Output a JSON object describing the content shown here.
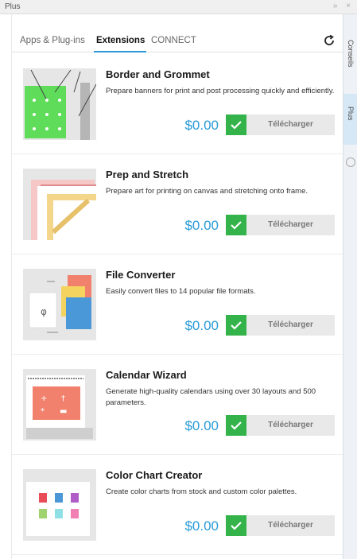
{
  "window": {
    "title": "Plus"
  },
  "tabs": [
    {
      "label": "Apps & Plug-ins",
      "active": false
    },
    {
      "label": "Extensions",
      "active": true
    },
    {
      "label": "CONNECT",
      "active": false
    }
  ],
  "items": [
    {
      "title": "Border and Grommet",
      "description": "Prepare banners for print and post processing quickly and efficiently.",
      "price": "$0.00",
      "button": "Télécharger"
    },
    {
      "title": "Prep and Stretch",
      "description": "Prepare art for printing on canvas and stretching onto frame.",
      "price": "$0.00",
      "button": "Télécharger"
    },
    {
      "title": "File Converter",
      "description": "Easily convert files to 14 popular file formats.",
      "price": "$0.00",
      "button": "Télécharger"
    },
    {
      "title": "Calendar Wizard",
      "description": "Generate high-quality calendars using over 30 layouts and 500 parameters.",
      "price": "$0.00",
      "button": "Télécharger"
    },
    {
      "title": "Color Chart Creator",
      "description": "Create color charts from stock and custom color palettes.",
      "price": "$0.00",
      "button": "Télécharger"
    }
  ],
  "sidebar": {
    "tabs": [
      {
        "label": "Conseils",
        "active": false
      },
      {
        "label": "Plus",
        "active": true
      }
    ]
  },
  "colors": {
    "accent": "#2a9bd8",
    "check": "#34b34a"
  },
  "icons": [
    "refresh-icon",
    "check-icon",
    "add-icon"
  ]
}
